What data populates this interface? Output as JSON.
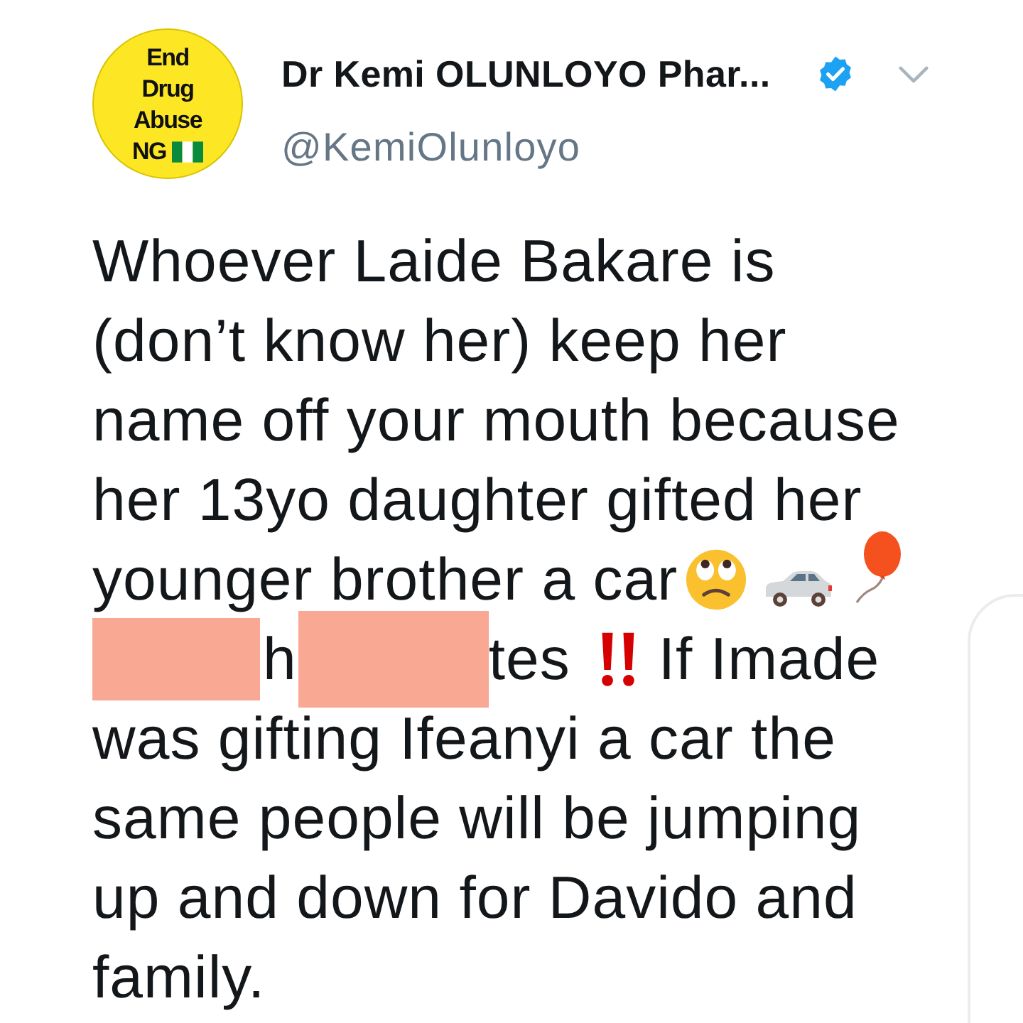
{
  "author": {
    "avatar_text": [
      "End",
      "Drug",
      "Abuse",
      "NG"
    ],
    "name": "Dr Kemi OLUNLOYO Phar...",
    "verified": true,
    "handle": "@KemiOlunloyo"
  },
  "body": {
    "lines": [
      {
        "segments": [
          {
            "kind": "text",
            "text": "Whoever Laide Bakare is"
          }
        ]
      },
      {
        "segments": [
          {
            "kind": "text",
            "text": "(don’t know her) keep her"
          }
        ]
      },
      {
        "segments": [
          {
            "kind": "text",
            "text": "name off your mouth because"
          }
        ]
      },
      {
        "segments": [
          {
            "kind": "text",
            "text": "her 13yo daughter gifted her"
          }
        ]
      },
      {
        "segments": [
          {
            "kind": "text",
            "text": "younger brother a car"
          },
          {
            "kind": "eyeroll"
          },
          {
            "kind": "car"
          },
          {
            "kind": "balloon"
          }
        ]
      },
      {
        "segments": [
          {
            "kind": "redaction"
          },
          {
            "kind": "text",
            "text": "h"
          },
          {
            "kind": "redaction"
          },
          {
            "kind": "text",
            "text": "tes"
          },
          {
            "kind": "exclamation"
          },
          {
            "kind": "text",
            "text": "If Imade"
          }
        ]
      },
      {
        "segments": [
          {
            "kind": "text",
            "text": "was gifting Ifeanyi a car the"
          }
        ]
      },
      {
        "segments": [
          {
            "kind": "text",
            "text": "same people will be jumping"
          }
        ]
      },
      {
        "segments": [
          {
            "kind": "text",
            "text": "up and down for Davido and"
          }
        ]
      },
      {
        "segments": [
          {
            "kind": "text",
            "text": "family."
          }
        ]
      }
    ]
  }
}
